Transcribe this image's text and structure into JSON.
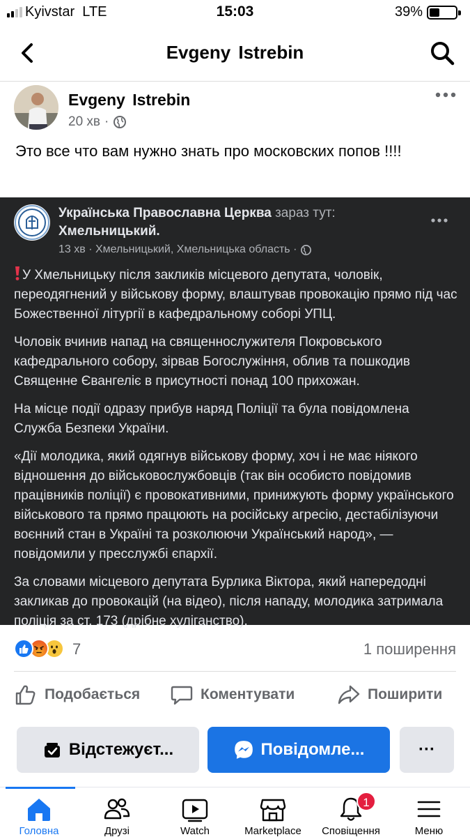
{
  "status_bar": {
    "carrier": "Kyivstar",
    "network": "LTE",
    "time": "15:03",
    "battery_percent": "39%",
    "battery_level": 0.39
  },
  "header": {
    "title": "Evgeny  Istrebin",
    "back_icon": "chevron-left-icon",
    "search_icon": "search-icon"
  },
  "post": {
    "author": "Evgeny  Istrebin",
    "time": "20 хв",
    "separator": "·",
    "privacy_icon": "globe-icon",
    "text": "Это все что вам нужно знать про московских попов !!!!",
    "shared": {
      "page_name": "Українська Православна Церква",
      "location_prefix": "зараз тут:",
      "location": "Хмельницький.",
      "meta": "13 хв · Хмельницький, Хмельницька область ·",
      "paragraphs": [
        "У Хмельницьку після закликів місцевого депутата, чоловік, переодягнений у військову форму, влаштував провокацію прямо під час Божественної літургії в кафедральному соборі УПЦ.",
        "Чоловік вчинив напад на священнослужителя Покровського кафедрального собору, зірвав Богослужіння, облив та пошкодив Священне Євангеліє в присутності понад 100 прихожан.",
        "На місце події одразу прибув наряд Поліції та була повідомлена Служба Безпеки України.",
        "«Дії молодика, який одягнув військову форму, хоч і не має ніякого відношення до військовослужбовців (так він особисто повідомив працівників поліції) є провокативними, принижують форму українського військового та прямо працюють на російську агресію, дестабілізуючи воєнний стан в Україні та розколюючи Український народ», — повідомили у пресслужбі єпархії.",
        "За словами місцевого депутата Бурлика Віктора, який напередодні закликав до провокацій (на відео), після нападу, молодика затримала поліція за ст. 173 (дрібне хуліганство)."
      ]
    },
    "reactions": {
      "icons": [
        "like-reaction-icon",
        "angry-reaction-icon",
        "wow-reaction-icon"
      ],
      "count": "7",
      "shares": "1 поширення"
    },
    "actions": {
      "like": "Подобається",
      "comment": "Коментувати",
      "share": "Поширити"
    }
  },
  "profile_buttons": {
    "follow": "Відстежуєт...",
    "message": "Повідомле...",
    "more": "···"
  },
  "nav": {
    "items": [
      {
        "label": "Головна",
        "icon": "home-icon"
      },
      {
        "label": "Друзі",
        "icon": "friends-icon"
      },
      {
        "label": "Watch",
        "icon": "watch-icon"
      },
      {
        "label": "Marketplace",
        "icon": "marketplace-icon"
      },
      {
        "label": "Сповіщення",
        "icon": "bell-icon",
        "badge": "1"
      },
      {
        "label": "Меню",
        "icon": "menu-icon"
      }
    ]
  },
  "colors": {
    "accent": "#1877f2",
    "message_button": "#1b74e4",
    "badge": "#e41e3f",
    "shared_background": "#242526"
  }
}
